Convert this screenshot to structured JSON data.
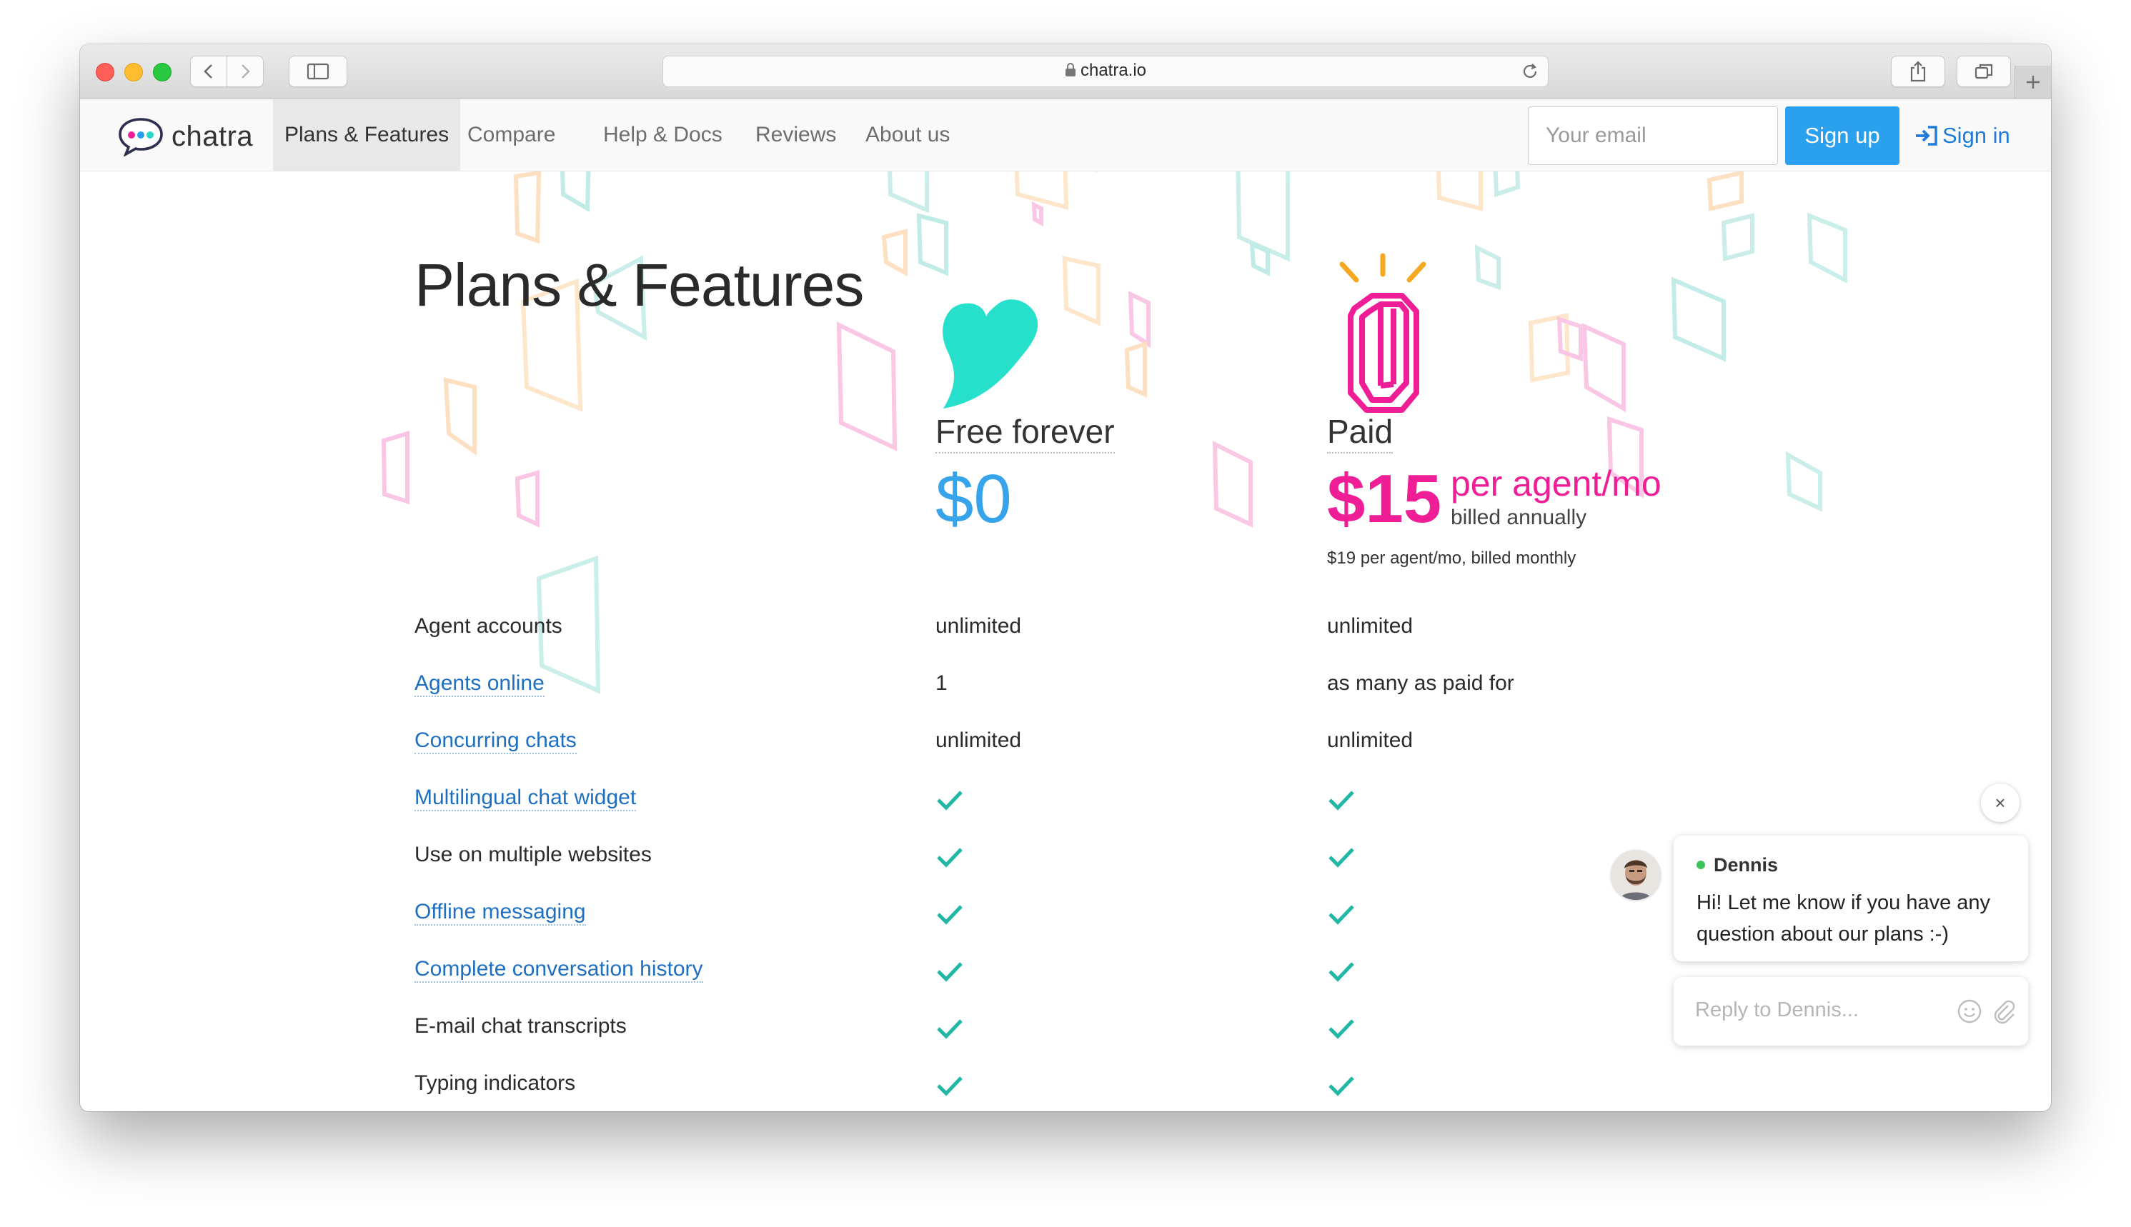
{
  "browser": {
    "url": "chatra.io"
  },
  "nav": {
    "logo_text": "chatra",
    "links": [
      "Plans & Features",
      "Compare",
      "Help & Docs",
      "Reviews",
      "About us"
    ],
    "email_placeholder": "Your email",
    "signup_label": "Sign up",
    "signin_label": "Sign in"
  },
  "page": {
    "title": "Plans & Features"
  },
  "plans": {
    "free": {
      "name": "Free forever",
      "price": "$0"
    },
    "paid": {
      "name": "Paid",
      "price": "$15",
      "per": "per agent/mo",
      "billed": "billed annually",
      "monthly_note": "$19 per agent/mo, billed monthly"
    }
  },
  "features": [
    {
      "label": "Agent accounts",
      "free": "unlimited",
      "paid": "unlimited"
    },
    {
      "label": "Agents online",
      "free": "1",
      "paid": "as many as paid for"
    },
    {
      "label": "Concurring chats",
      "free": "unlimited",
      "paid": "unlimited"
    },
    {
      "label": "Multilingual chat widget",
      "free": "check",
      "paid": "check"
    },
    {
      "label": "Use on multiple websites",
      "free": "check",
      "paid": "check"
    },
    {
      "label": "Offline messaging",
      "free": "check",
      "paid": "check"
    },
    {
      "label": "Complete conversation history",
      "free": "check",
      "paid": "check"
    },
    {
      "label": "E-mail chat transcripts",
      "free": "check",
      "paid": "check"
    },
    {
      "label": "Typing indicators",
      "free": "check",
      "paid": "check"
    }
  ],
  "chat": {
    "close_glyph": "×",
    "agent_name": "Dennis",
    "message": "Hi! Let me know if you have any question about our plans :-)",
    "reply_placeholder": "Reply to Dennis..."
  },
  "colors": {
    "accent_blue": "#2aa0ef",
    "paid_pink": "#ef1e97",
    "free_teal": "#27e0cc",
    "check_teal": "#20b8a4",
    "link_blue": "#1e6fc0"
  }
}
